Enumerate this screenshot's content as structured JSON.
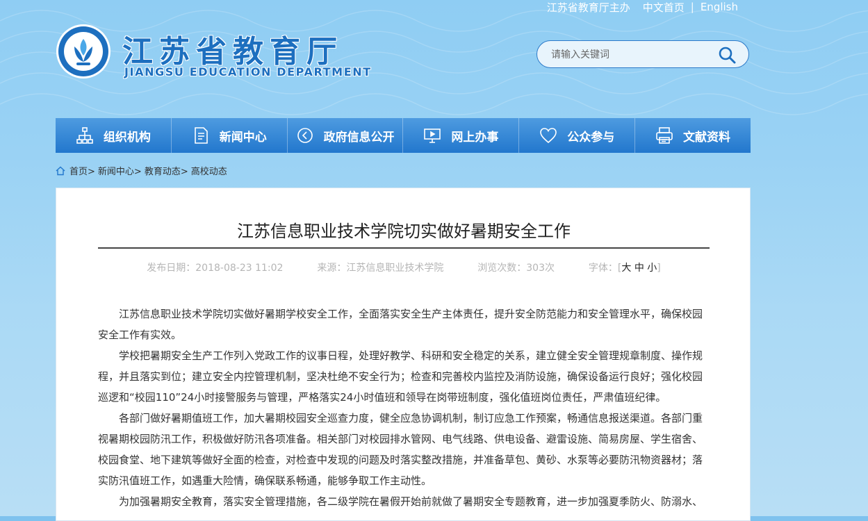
{
  "top_links": {
    "sponsor": "江苏省教育厅主办",
    "home_cn": "中文首页",
    "separator": "|",
    "english": "English"
  },
  "logo": {
    "title_cn": "江苏省教育厅",
    "title_en": "JIANGSU EDUCATION DEPARTMENT"
  },
  "search": {
    "placeholder": "请输入关键词"
  },
  "nav": {
    "items": [
      {
        "label": "组织机构",
        "icon": "org-chart-icon"
      },
      {
        "label": "新闻中心",
        "icon": "document-icon"
      },
      {
        "label": "政府信息公开",
        "icon": "arrow-circle-icon"
      },
      {
        "label": "网上办事",
        "icon": "monitor-icon"
      },
      {
        "label": "公众参与",
        "icon": "heart-icon"
      },
      {
        "label": "文献资料",
        "icon": "printer-icon"
      }
    ]
  },
  "breadcrumb": {
    "home": "首页>",
    "news": "新闻中心>",
    "edu": "教育动态>",
    "current": "高校动态"
  },
  "article": {
    "title": "江苏信息职业技术学院切实做好暑期安全工作",
    "meta": {
      "date_label": "发布日期：",
      "date": "2018-08-23 11:02",
      "source_label": "来源：",
      "source": "江苏信息职业技术学院",
      "views_label": "浏览次数：",
      "views": "303次",
      "font_label": "字体：",
      "bracket_open": "[",
      "size_large": "大",
      "size_medium": "中",
      "size_small": "小",
      "bracket_close": "]"
    },
    "paragraphs": [
      "江苏信息职业技术学院切实做好暑期学校安全工作，全面落实安全生产主体责任，提升安全防范能力和安全管理水平，确保校园安全工作有实效。",
      "学校把暑期安全生产工作列入党政工作的议事日程，处理好教学、科研和安全稳定的关系，建立健全安全管理规章制度、操作规程，并且落实到位；建立安全内控管理机制，坚决杜绝不安全行为；检查和完善校内监控及消防设施，确保设备运行良好；强化校园巡逻和“校园110”24小时接警服务与管理，严格落实24小时值班和领导在岗带班制度，强化值班岗位责任，严肃值班纪律。",
      "各部门做好暑期值班工作，加大暑期校园安全巡查力度，健全应急协调机制，制订应急工作预案，畅通信息报送渠道。各部门重视暑期校园防汛工作，积极做好防汛各项准备。相关部门对校园排水管网、电气线路、供电设备、避雷设施、简易房屋、学生宿舍、校园食堂、地下建筑等做好全面的检查，对检查中发现的问题及时落实整改措施，并准备草包、黄砂、水泵等必要防汛物资器材；落实防汛值班工作，如遇重大险情，确保联系畅通，能够争取工作主动性。",
      "为加强暑期安全教育，落实安全管理措施，各二级学院在暑假开始前就做了暑期安全专题教育，进一步加强夏季防火、防溺水、"
    ]
  },
  "colors": {
    "brand_blue": "#1d6fbf",
    "nav_blue": "#2277cd",
    "background": "#9ad2f4"
  }
}
